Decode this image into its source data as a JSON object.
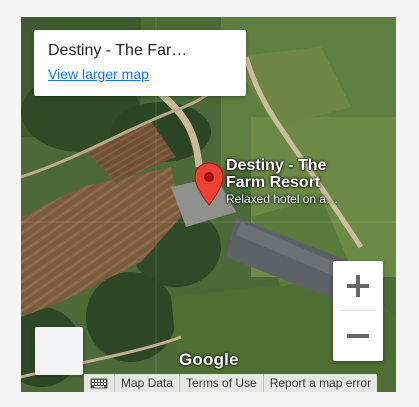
{
  "info_card": {
    "title": "Destiny - The Far…",
    "link": "View larger map"
  },
  "marker": {
    "name_line1": "Destiny - The",
    "name_line2": "Farm Resort",
    "description": "Relaxed hotel on a…"
  },
  "zoom": {
    "in_label": "+",
    "out_label": "−"
  },
  "logo": "Google",
  "attribution": {
    "map_data": "Map Data",
    "terms": "Terms of Use",
    "report": "Report a map error"
  },
  "colors": {
    "pin_red": "#ea4335",
    "link_blue": "#1a73e8"
  },
  "icons": {
    "pin": "map-pin-icon",
    "keyboard": "keyboard-icon",
    "zoom_in": "plus-icon",
    "zoom_out": "minus-icon"
  }
}
